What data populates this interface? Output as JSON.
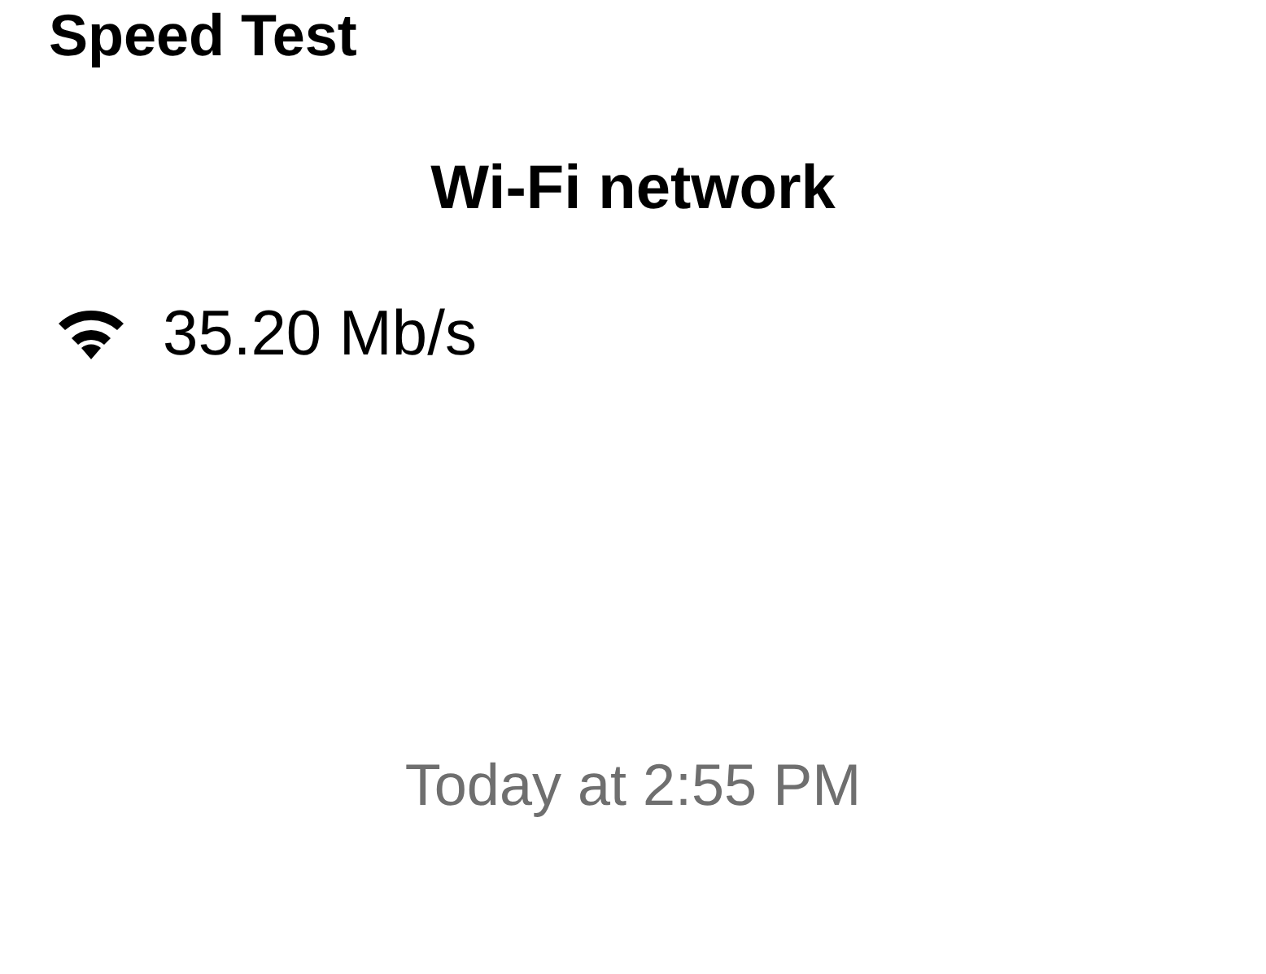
{
  "title": "Speed Test",
  "network": {
    "heading": "Wi-Fi network",
    "speed": "35.20 Mb/s"
  },
  "timestamp": "Today at 2:55 PM"
}
